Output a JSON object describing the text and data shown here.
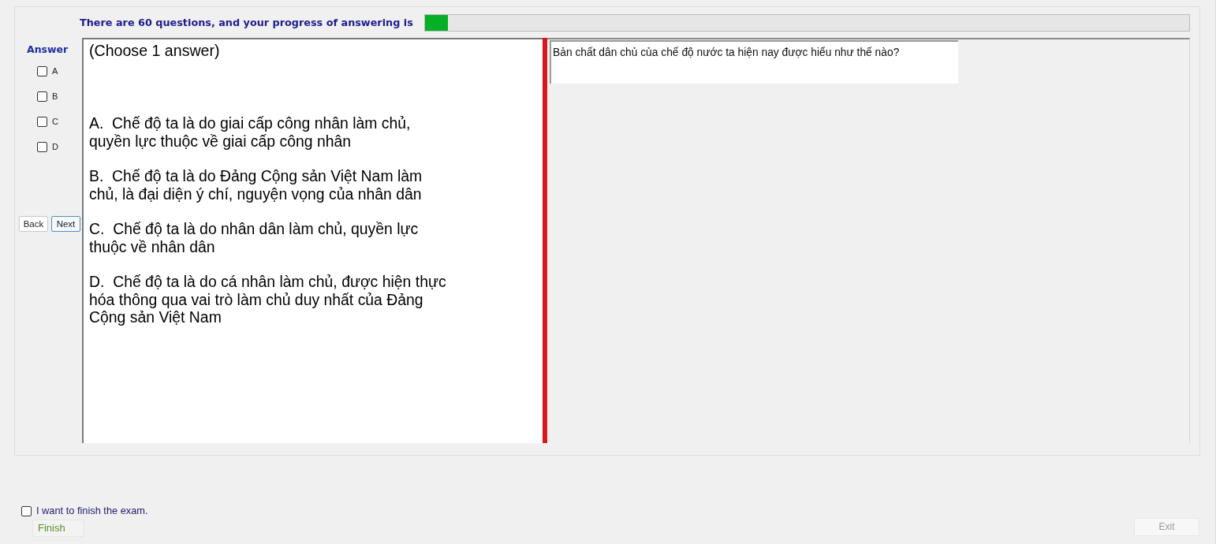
{
  "header": {
    "progress_text": "There are 60 questions, and your progress of answering is",
    "progress": {
      "level": 0.03
    }
  },
  "answer_panel": {
    "title": "Answer",
    "options": [
      {
        "label": "A",
        "checked": false
      },
      {
        "label": "B",
        "checked": false
      },
      {
        "label": "C",
        "checked": false
      },
      {
        "label": "D",
        "checked": false
      }
    ],
    "buttons": [
      {
        "label": "Back",
        "focused": false
      },
      {
        "label": "Next",
        "focused": true
      }
    ]
  },
  "question": {
    "instruction": "(Choose 1 answer)",
    "choices": [
      "A.  Chế độ ta là do giai cấp công nhân làm chủ, quyền lực thuộc về giai cấp công nhân",
      "B.  Chế độ ta là do Đảng Cộng sản Việt Nam làm chủ, là đại diện ý chí, nguyện vọng của nhân dân",
      "C.  Chế độ ta là do nhân dân làm chủ, quyền lực thuộc về nhân dân",
      "D.  Chế độ ta là do cá nhân làm chủ, được hiện thực hóa thông qua vai trò làm chủ duy nhất của Đảng Cộng sản Việt Nam"
    ]
  },
  "question_text": "Bản chất dân chủ của chế độ nước ta hiện nay được hiểu như thế nào?",
  "footer": {
    "finish_checkbox": {
      "label": "I want to finish the exam.",
      "checked": false
    },
    "finish_button": {
      "label": "Finish"
    },
    "exit_button": {
      "label": "Exit",
      "disabled": true
    }
  }
}
